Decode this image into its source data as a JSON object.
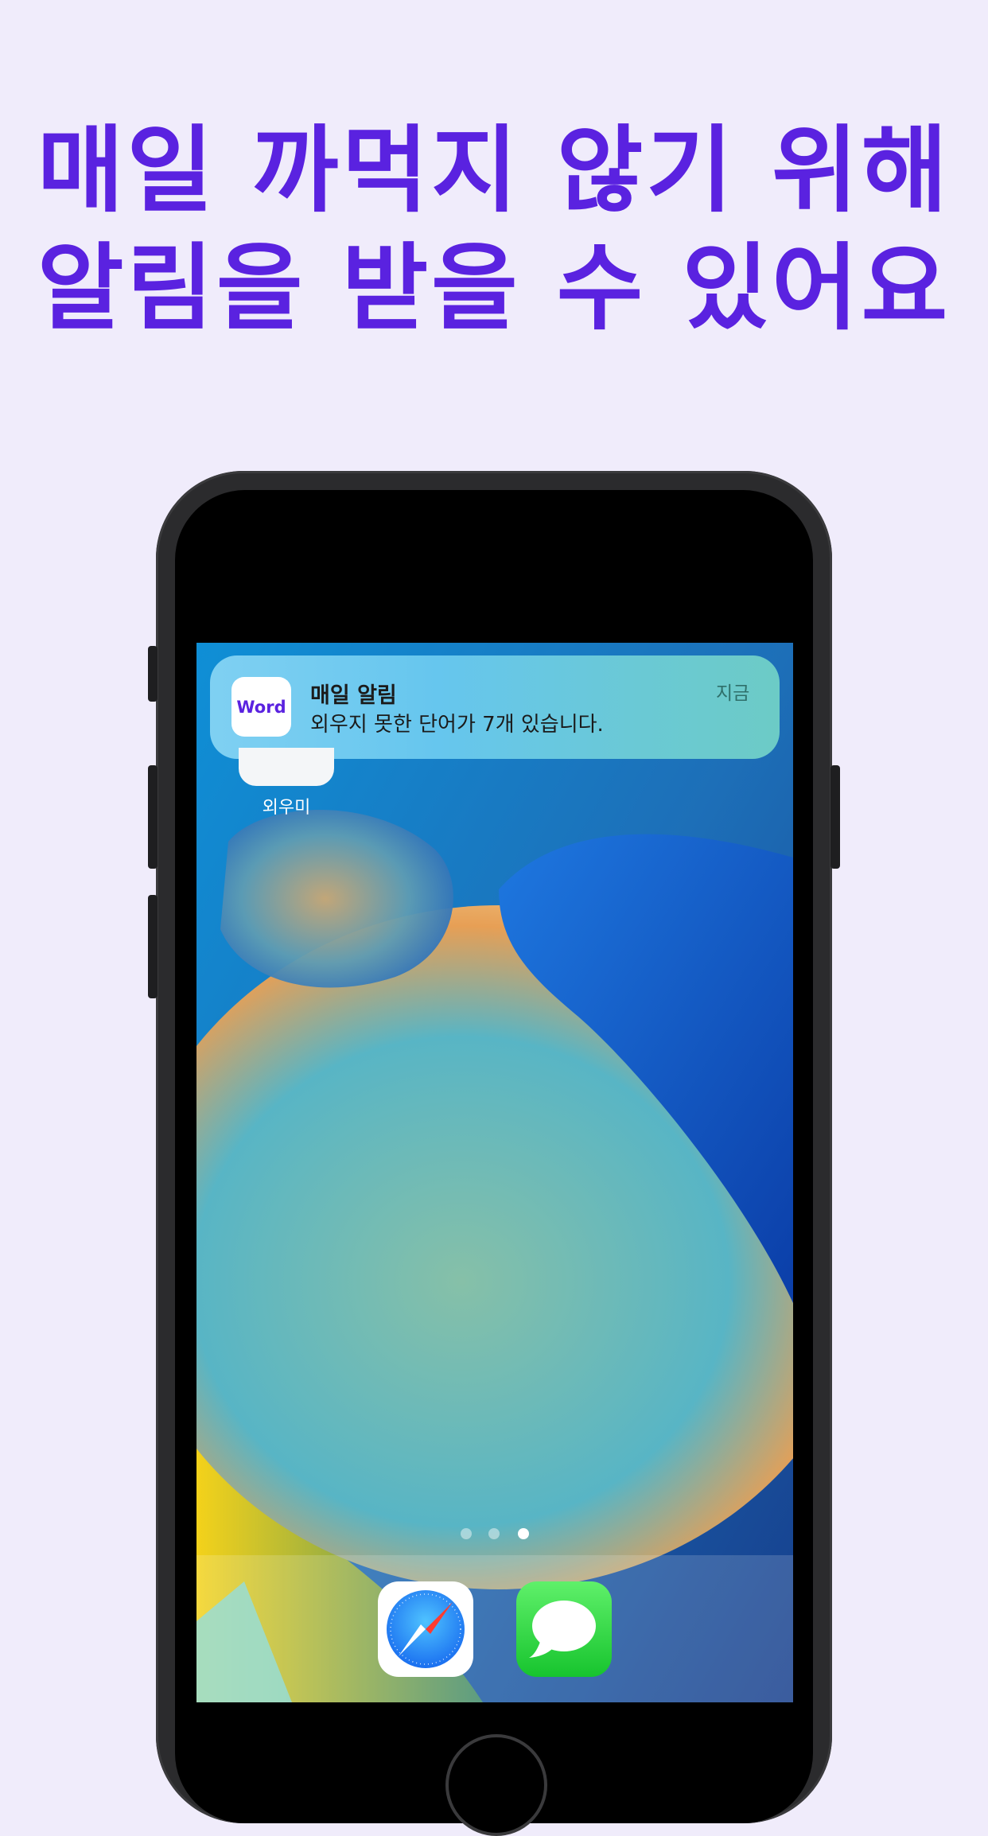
{
  "headline": {
    "line1": "매일 까먹지 않기 위해",
    "line2": "알림을 받을 수 있어요"
  },
  "notification": {
    "app_icon_text": "Word",
    "title": "매일 알림",
    "body": "외우지 못한 단어가 7개 있습니다.",
    "time": "지금"
  },
  "home_screen": {
    "app_label": "외우미",
    "page_count": 3,
    "active_page": 3,
    "dock_apps": [
      "safari-icon",
      "messages-icon"
    ]
  },
  "colors": {
    "background": "#f0ecfb",
    "headline": "#5a22e0",
    "accent": "#5a22e0"
  }
}
